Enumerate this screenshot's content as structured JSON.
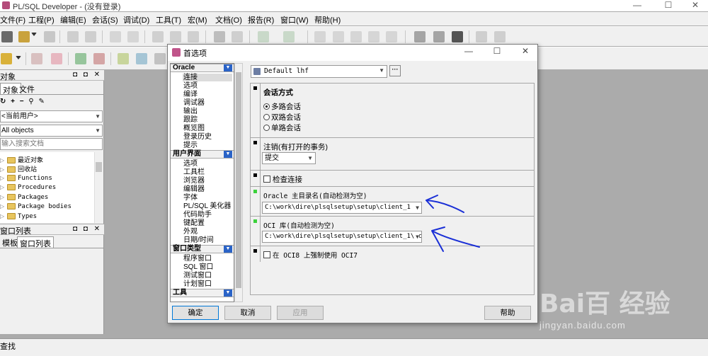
{
  "app": {
    "title": "PL/SQL Developer - (没有登录)",
    "controls": [
      "—",
      "☐",
      "✕"
    ]
  },
  "menu": [
    "文件(F)",
    "工程(P)",
    "编辑(E)",
    "会话(S)",
    "调试(D)",
    "工具(T)",
    "宏(M)",
    "文档(O)",
    "报告(R)",
    "窗口(W)",
    "帮助(H)"
  ],
  "objects_panel": {
    "title": "对象",
    "header_buttons": "◘ ◘ ✕",
    "tabs": [
      "对象",
      "文件"
    ],
    "user_combo": "<当前用户>",
    "filter_combo": "All objects",
    "search_placeholder": "输入搜索文档",
    "tree": [
      "最近对象",
      "回收站",
      "Functions",
      "Procedures",
      "Packages",
      "Package bodies",
      "Types"
    ]
  },
  "window_list_panel": {
    "title": "窗口列表",
    "header_buttons": "◘ ◘ ✕",
    "tabs": [
      "模板",
      "窗口列表"
    ]
  },
  "bottom": {
    "find_label": "查找"
  },
  "dialog": {
    "title": "首选项",
    "controls": [
      "—",
      "☐",
      "✕"
    ],
    "groups": [
      {
        "name": "Oracle",
        "items": [
          "连接",
          "选项",
          "编译",
          "调试器",
          "输出",
          "跟踪",
          "概览图",
          "登录历史",
          "提示"
        ]
      },
      {
        "name": "用户界面",
        "items": [
          "选项",
          "工具栏",
          "浏览器",
          "编辑器",
          "字体",
          "PL/SQL 美化器",
          "代码助手",
          "键配置",
          "外观",
          "日期/时间"
        ]
      },
      {
        "name": "窗口类型",
        "items": [
          "程序窗口",
          "SQL 窗口",
          "测试窗口",
          "计划窗口"
        ]
      },
      {
        "name": "工具",
        "items": []
      }
    ],
    "selected_item": "连接",
    "profile": "Default lhf",
    "dots": "···",
    "sections": {
      "session_mode": {
        "title": "会话方式",
        "options": [
          "多路会话",
          "双路会话",
          "单路会话"
        ],
        "selected": 0
      },
      "logoff": {
        "title": "注销(有打开的事务)",
        "value": "提交"
      },
      "check_connection": {
        "label": "检查连接",
        "checked": false
      },
      "oracle_home": {
        "title": "Oracle 主目录名(自动检测为空)",
        "value": "C:\\work\\dire\\plsqlsetup\\setup\\client_1"
      },
      "oci_library": {
        "title": "OCI 库(自动检测为空)",
        "value": "C:\\work\\dire\\plsqlsetup\\setup\\client_1\\oc"
      },
      "force_oci7": {
        "label": "在 OCI8 上强制使用 OCI7",
        "checked": false
      }
    },
    "buttons": {
      "ok": "确定",
      "cancel": "取消",
      "apply": "应用",
      "help": "帮助"
    }
  },
  "watermark": {
    "brand": "Bai百 经验",
    "url": "jingyan.baidu.com"
  },
  "colors": {
    "accent": "#2a63c7",
    "annotation": "#1a2fd6",
    "marker_green": "#3bd13b"
  }
}
